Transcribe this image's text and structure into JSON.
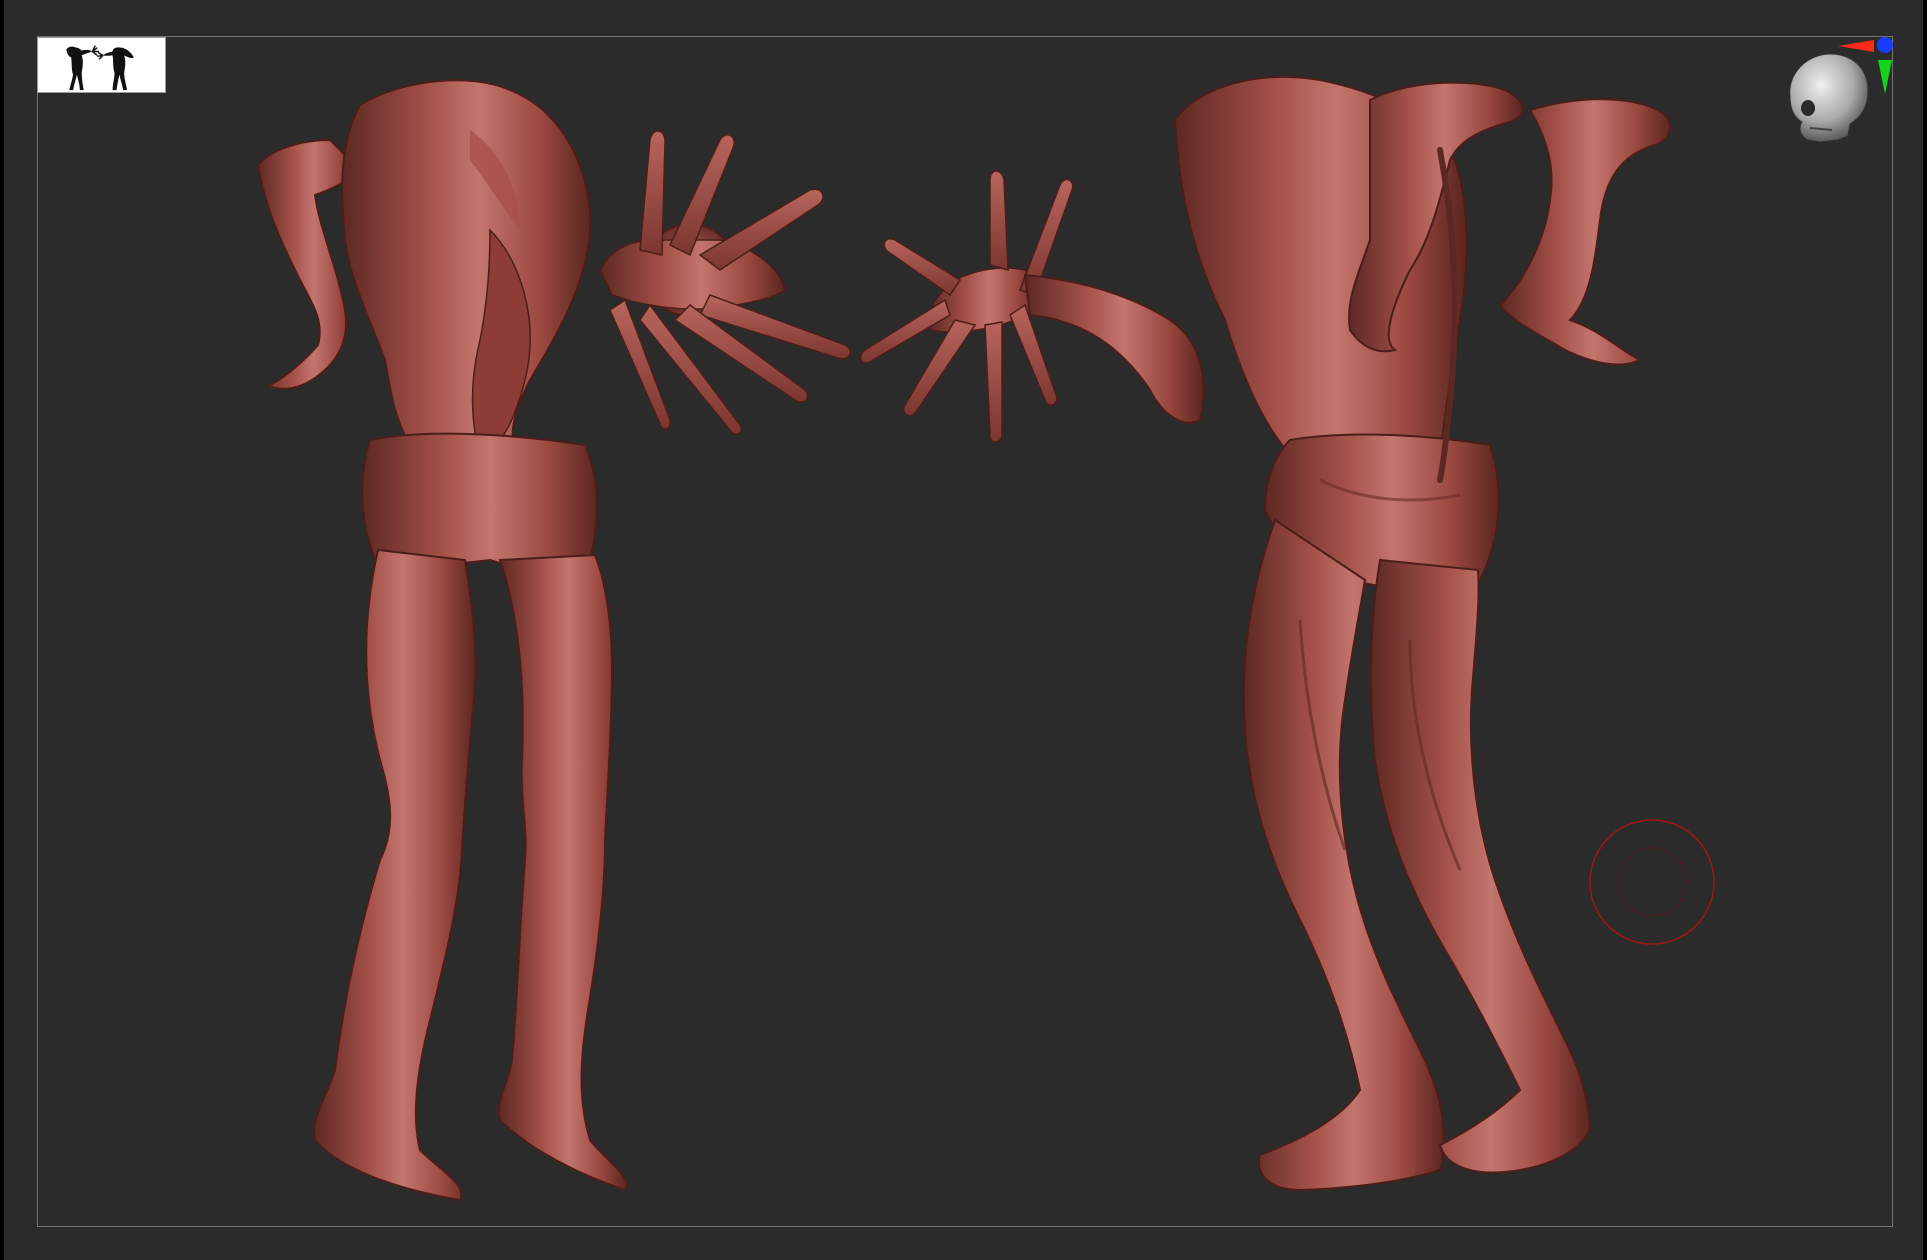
{
  "app": {
    "type": "3d-sculpting-viewport",
    "background_color": "#2b2b2b",
    "frame_color": "#747474"
  },
  "navigator": {
    "thumbnail_icon": "silhouette-pair-icon",
    "thumbnail_bg": "#ffffff"
  },
  "gizmo": {
    "icon": "skull-orientation-icon",
    "axis_colors": {
      "x": "#ff2a1a",
      "y": "#13d41a",
      "z": "#1a3cff"
    }
  },
  "brush": {
    "icon": "brush-cursor-icon",
    "ring_color": "#a01616"
  },
  "models": [
    {
      "name": "creature-front-view",
      "skin_color": "#9b4a3e"
    },
    {
      "name": "creature-back-view",
      "skin_color": "#9b4a3e"
    }
  ]
}
